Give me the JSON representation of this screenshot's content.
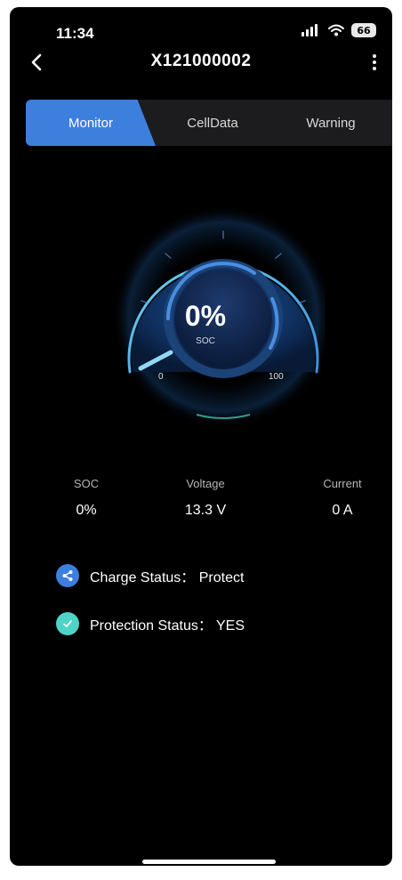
{
  "status_bar": {
    "time": "11:34",
    "battery": "66"
  },
  "nav": {
    "title": "X121000002"
  },
  "tabs": [
    {
      "label": "Monitor",
      "active": true
    },
    {
      "label": "CellData",
      "active": false
    },
    {
      "label": "Warning",
      "active": false
    }
  ],
  "gauge": {
    "value": "0%",
    "label": "SOC",
    "min": "0",
    "max": "100",
    "level": 0
  },
  "stats": {
    "soc": {
      "label": "SOC",
      "value": "0%"
    },
    "voltage": {
      "label": "Voltage",
      "value": "13.3 V"
    },
    "current": {
      "label": "Current",
      "value": "0 A"
    }
  },
  "status": {
    "charge": "Charge Status： Protect",
    "protection": "Protection Status： YES"
  },
  "colors": {
    "accent": "#3d7fdd",
    "success": "#4fd3c7",
    "background": "#000000"
  }
}
